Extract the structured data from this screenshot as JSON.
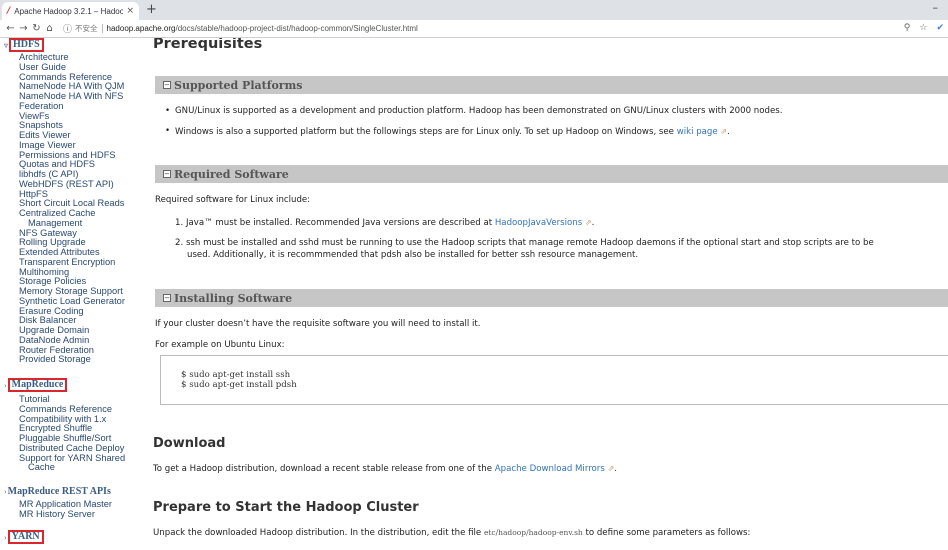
{
  "browser": {
    "tab_title": "Apache Hadoop 3.2.1 – Hadoo",
    "tab_close": "×",
    "new_tab": "+",
    "minimize": "–",
    "insecure_label": "不安全",
    "url_host": "hadoop.apache.org",
    "url_path": "/docs/stable/hadoop-project-dist/hadoop-common/SingleCluster.html",
    "icons": [
      "back-icon",
      "forward-icon",
      "reload-icon",
      "home-icon",
      "info-icon",
      "zoom-icon",
      "star-icon",
      "extension-icon"
    ]
  },
  "nav": {
    "hdfs": {
      "label": "HDFS",
      "items": [
        "Architecture",
        "User Guide",
        "Commands Reference",
        "NameNode HA With QJM",
        "NameNode HA With NFS",
        "Federation",
        "ViewFs",
        "Snapshots",
        "Edits Viewer",
        "Image Viewer",
        "Permissions and HDFS",
        "Quotas and HDFS",
        "libhdfs (C API)",
        "WebHDFS (REST API)",
        "HttpFS",
        "Short Circuit Local Reads",
        "Centralized Cache",
        "Management",
        "NFS Gateway",
        "Rolling Upgrade",
        "Extended Attributes",
        "Transparent Encryption",
        "Multihoming",
        "Storage Policies",
        "Memory Storage Support",
        "Synthetic Load Generator",
        "Erasure Coding",
        "Disk Balancer",
        "Upgrade Domain",
        "DataNode Admin",
        "Router Federation",
        "Provided Storage"
      ]
    },
    "mapreduce": {
      "label": "MapReduce",
      "items": [
        "Tutorial",
        "Commands Reference",
        "Compatibility with 1.x",
        "Encrypted Shuffle",
        "Pluggable Shuffle/Sort",
        "Distributed Cache Deploy",
        "Support for YARN Shared",
        "Cache"
      ]
    },
    "mapreduce_rest": {
      "label": "MapReduce REST APIs",
      "items": [
        "MR Application Master",
        "MR History Server"
      ]
    },
    "yarn": {
      "label": "YARN"
    }
  },
  "content": {
    "prereq_heading": "Prerequisites",
    "supported_platforms": {
      "title": "Supported Platforms",
      "bullet1": "GNU/Linux is supported as a development and production platform. Hadoop has been demonstrated on GNU/Linux clusters with 2000 nodes.",
      "bullet2_text": "Windows is also a supported platform but the followings steps are for Linux only. To set up Hadoop on Windows, see",
      "bullet2_link": "wiki page"
    },
    "required_software": {
      "title": "Required Software",
      "intro": "Required software for Linux include:",
      "item1_num": "1.",
      "item1_text": "Java™ must be installed. Recommended Java versions are described at",
      "item1_link": "HadoopJavaVersions",
      "item2_num": "2.",
      "item2_line1": "ssh must be installed and sshd must be running to use the Hadoop scripts that manage remote Hadoop daemons if the optional start and stop scripts are to be",
      "item2_line2": "used. Additionally, it is recommmended that pdsh also be installed for better ssh resource management."
    },
    "installing_software": {
      "title": "Installing Software",
      "line1": "If your cluster doesn’t have the requisite software you will need to install it.",
      "line2": "For example on Ubuntu Linux:",
      "code1": "$ sudo apt-get install ssh",
      "code2": "$ sudo apt-get install pdsh"
    },
    "download": {
      "heading": "Download",
      "text": "To get a Hadoop distribution, download a recent stable release from one of the",
      "link": "Apache Download Mirrors"
    },
    "prepare": {
      "heading": "Prepare to Start the Hadoop Cluster",
      "text_before": "Unpack the downloaded Hadoop distribution. In the distribution, edit the file",
      "file": "etc/hadoop/hadoop-env.sh",
      "text_after": "to define some parameters as follows:"
    }
  }
}
